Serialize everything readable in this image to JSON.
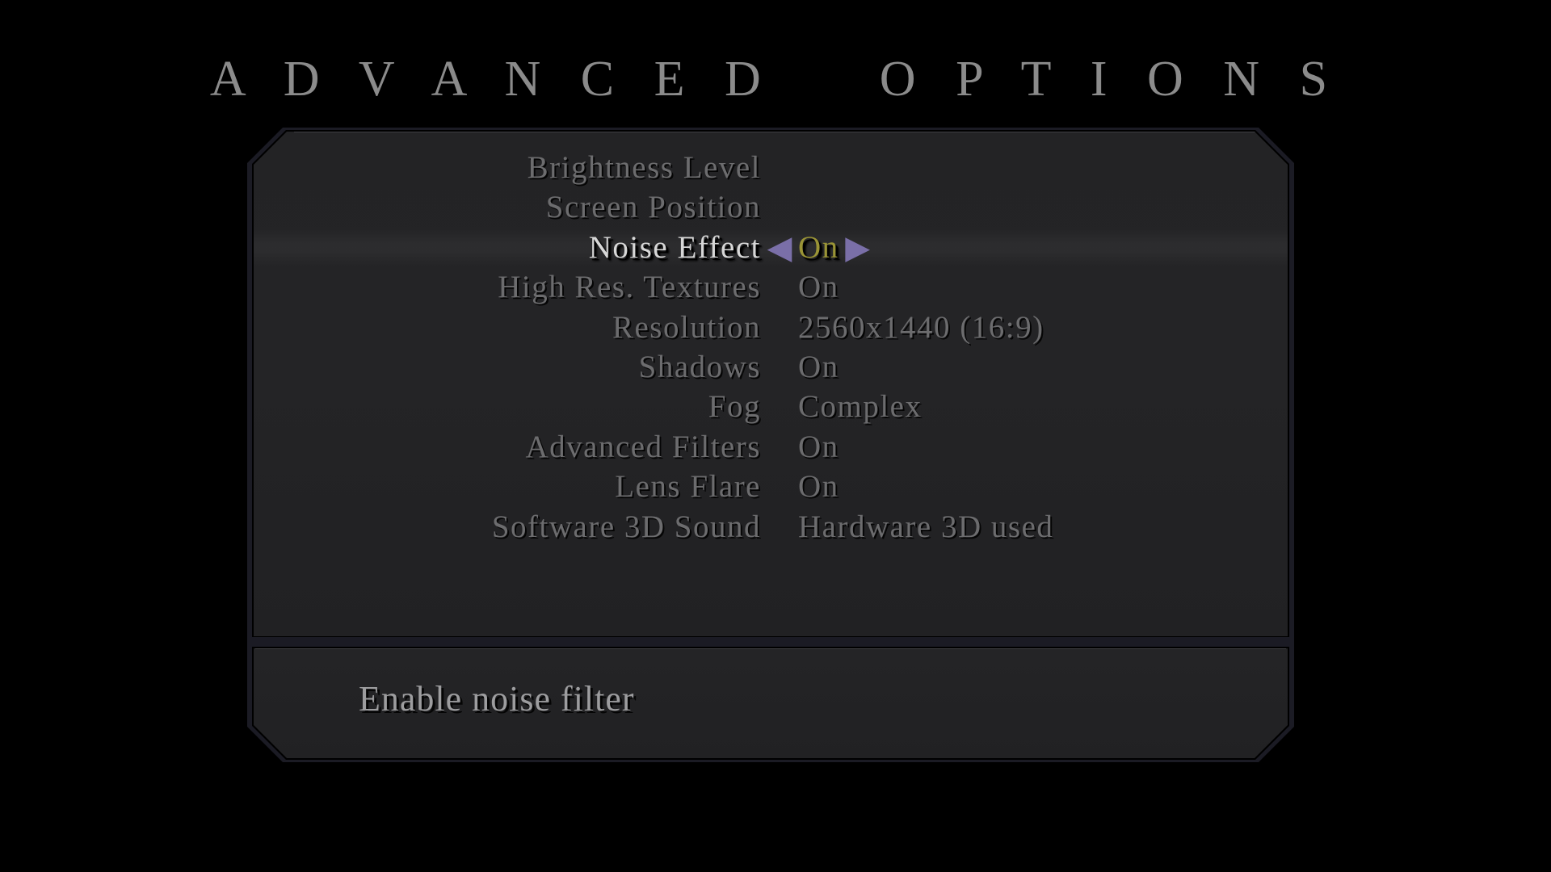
{
  "screen": {
    "title": "A D V A N C E D    O P T I O N S",
    "background_color": "#000000"
  },
  "colors": {
    "title_text": "#8b8b8b",
    "item_text": "#6c6c6e",
    "selected_label": "#d7d7d7",
    "selected_value": "#9a9436",
    "arrow": "#7a6fa8",
    "panel_background": "#232325",
    "panel_border": "#1b1b24",
    "footer_text": "#9d9d9f"
  },
  "menu": {
    "selected_index": 2,
    "arrow_left_icon": "◀",
    "arrow_right_icon": "▶",
    "items": [
      {
        "label": "Brightness Level",
        "value": ""
      },
      {
        "label": "Screen Position",
        "value": ""
      },
      {
        "label": "Noise Effect",
        "value": "On"
      },
      {
        "label": "High Res. Textures",
        "value": "On"
      },
      {
        "label": "Resolution",
        "value": "2560x1440 (16:9)"
      },
      {
        "label": "Shadows",
        "value": "On"
      },
      {
        "label": "Fog",
        "value": "Complex"
      },
      {
        "label": "Advanced Filters",
        "value": "On"
      },
      {
        "label": "Lens Flare",
        "value": "On"
      },
      {
        "label": "Software 3D Sound",
        "value": "Hardware 3D used"
      }
    ]
  },
  "footer": {
    "description": "Enable noise filter"
  }
}
